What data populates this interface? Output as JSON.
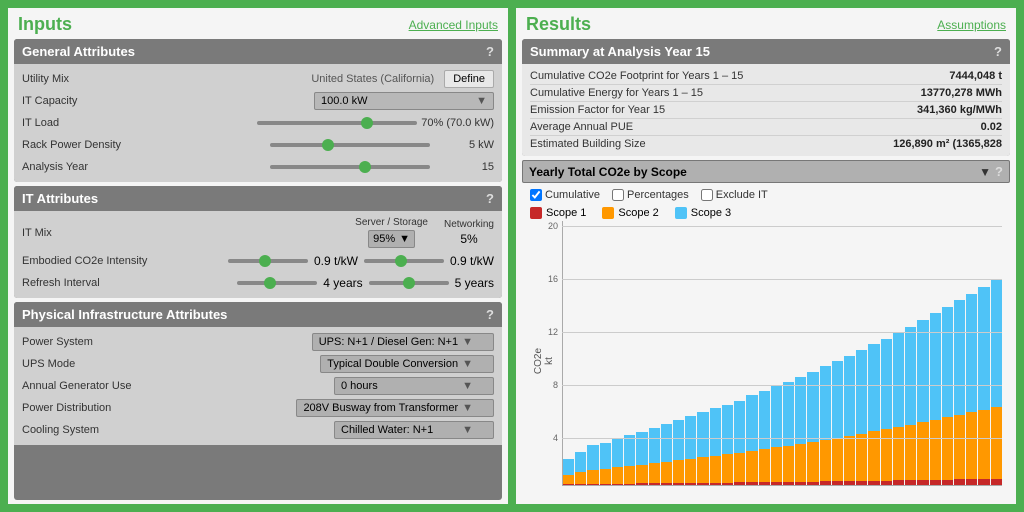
{
  "left_panel": {
    "title": "Inputs",
    "advanced_link": "Advanced Inputs",
    "general_attributes": {
      "header": "General Attributes",
      "rows": [
        {
          "label": "Utility Mix",
          "value": "United States (California)",
          "type": "text_button",
          "button": "Define"
        },
        {
          "label": "IT Capacity",
          "value": "100.0 kW",
          "type": "capacity_dropdown",
          "slider_pct": 50
        },
        {
          "label": "IT Load",
          "value": "70% (70.0 kW)",
          "type": "slider",
          "slider_pct": 70
        },
        {
          "label": "Rack Power Density",
          "value": "5 kW",
          "type": "slider",
          "slider_pct": 35
        },
        {
          "label": "Analysis Year",
          "value": "15",
          "type": "slider",
          "slider_pct": 60
        }
      ]
    },
    "it_attributes": {
      "header": "IT Attributes",
      "server_label": "Server / Storage",
      "networking_label": "Networking",
      "server_value": "95%",
      "networking_value": "5%",
      "rows": [
        {
          "label": "Embodied CO2e Intensity",
          "left_val": "0.9 t/kW",
          "right_val": "0.9 t/kW"
        },
        {
          "label": "Refresh Interval",
          "left_val": "4 years",
          "right_val": "5 years"
        }
      ]
    },
    "physical_attributes": {
      "header": "Physical Infrastructure Attributes",
      "rows": [
        {
          "label": "Power System",
          "value": "UPS: N+1 / Diesel Gen: N+1"
        },
        {
          "label": "UPS Mode",
          "value": "Typical Double Conversion"
        },
        {
          "label": "Annual Generator Use",
          "value": "0 hours"
        },
        {
          "label": "Power Distribution",
          "value": "208V Busway from Transformer"
        },
        {
          "label": "Cooling System",
          "value": "Chilled Water: N+1"
        }
      ]
    }
  },
  "right_panel": {
    "title": "Results",
    "assumptions_link": "Assumptions",
    "summary": {
      "header": "Summary at Analysis Year 15",
      "rows": [
        {
          "key": "Cumulative CO2e Footprint for Years 1 – 15",
          "value": "7444,048 t"
        },
        {
          "key": "Cumulative Energy for Years 1 – 15",
          "value": "13770,278 MWh"
        },
        {
          "key": "Emission Factor for Year 15",
          "value": "341,360 kg/MWh"
        },
        {
          "key": "Average Annual PUE",
          "value": "0.02"
        },
        {
          "key": "Estimated Building Size",
          "value": "126,890 m² (1365,828"
        }
      ]
    },
    "chart": {
      "dropdown_label": "Yearly Total CO2e by Scope",
      "cumulative_label": "Cumulative",
      "percentages_label": "Percentages",
      "exclude_it_label": "Exclude IT",
      "cumulative_checked": true,
      "percentages_checked": false,
      "exclude_it_checked": false,
      "scopes": [
        {
          "name": "Scope 1",
          "color": "#c62828"
        },
        {
          "name": "Scope 2",
          "color": "#ff9800"
        },
        {
          "name": "Scope 3",
          "color": "#4fc3f7"
        }
      ],
      "y_labels": [
        "20",
        "16",
        "12",
        "8",
        "4"
      ],
      "y_axis_label": "CO2e\nkt",
      "bars": [
        2,
        2.5,
        3,
        3.2,
        3.5,
        3.8,
        4,
        4.3,
        4.6,
        4.9,
        5.2,
        5.5,
        5.8,
        6.1,
        6.4,
        6.8,
        7.1,
        7.5,
        7.8,
        8.2,
        8.6,
        9.0,
        9.4,
        9.8,
        10.2,
        10.7,
        11.1,
        11.6,
        12.0,
        12.5,
        13.0,
        13.5,
        14.0,
        14.5,
        15.0,
        15.5
      ],
      "scope2_fraction": 0.35,
      "scope1_fraction": 0.03
    }
  }
}
